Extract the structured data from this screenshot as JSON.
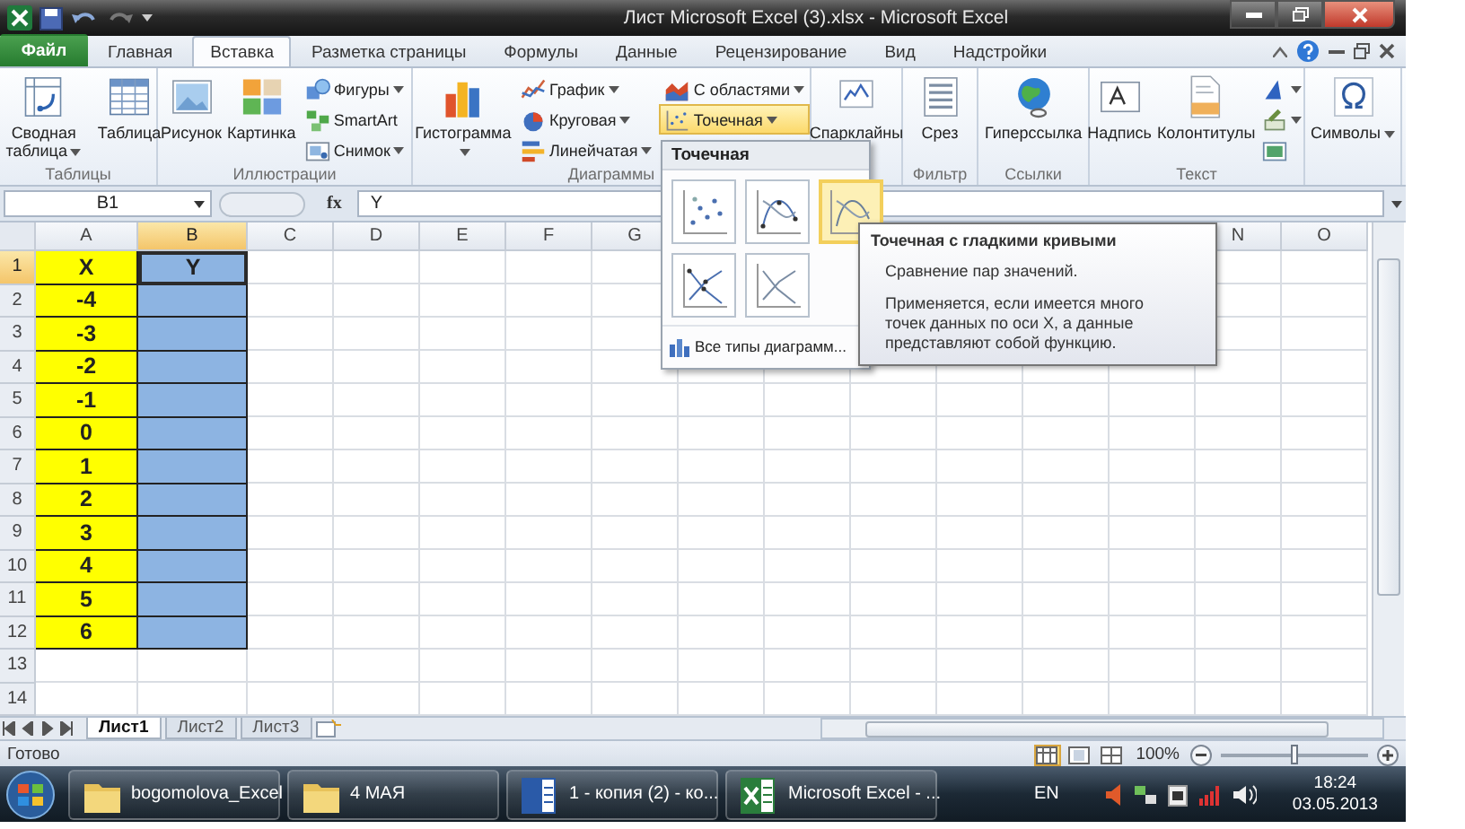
{
  "window": {
    "title": "Лист Microsoft Excel (3).xlsx - Microsoft Excel"
  },
  "ribbon_tabs": [
    {
      "label": "Файл",
      "kind": "file",
      "selected": false
    },
    {
      "label": "Главная",
      "kind": "tab",
      "selected": false
    },
    {
      "label": "Вставка",
      "kind": "tab",
      "selected": true
    },
    {
      "label": "Разметка страницы",
      "kind": "tab",
      "selected": false
    },
    {
      "label": "Формулы",
      "kind": "tab",
      "selected": false
    },
    {
      "label": "Данные",
      "kind": "tab",
      "selected": false
    },
    {
      "label": "Рецензирование",
      "kind": "tab",
      "selected": false
    },
    {
      "label": "Вид",
      "kind": "tab",
      "selected": false
    },
    {
      "label": "Надстройки",
      "kind": "tab",
      "selected": false
    }
  ],
  "ribbon_groups": [
    {
      "label": "Таблицы",
      "items": [
        {
          "kind": "large",
          "label": "Сводная таблица",
          "menu": true
        },
        {
          "kind": "large",
          "label": "Таблица",
          "menu": false
        }
      ]
    },
    {
      "label": "Иллюстрации",
      "items": [
        {
          "kind": "large",
          "label": "Рисунок",
          "menu": false
        },
        {
          "kind": "large",
          "label": "Картинка",
          "menu": false
        },
        {
          "kind": "stack",
          "items": [
            {
              "label": "Фигуры",
              "menu": true,
              "open": false
            },
            {
              "label": "SmartArt",
              "menu": false,
              "open": false
            },
            {
              "label": "Снимок",
              "menu": true,
              "open": false
            }
          ]
        }
      ]
    },
    {
      "label": "Диаграммы",
      "items": [
        {
          "kind": "large",
          "label": "Гистограмма",
          "menu": true
        },
        {
          "kind": "stack",
          "items": [
            {
              "label": "График",
              "menu": true,
              "open": false
            },
            {
              "label": "Круговая",
              "menu": true,
              "open": false
            },
            {
              "label": "Линейчатая",
              "menu": true,
              "open": false
            }
          ]
        },
        {
          "kind": "stack",
          "items": [
            {
              "label": "С областями",
              "menu": true,
              "open": false
            },
            {
              "label": "Точечная",
              "menu": true,
              "open": true
            }
          ]
        }
      ]
    },
    {
      "items": [
        {
          "kind": "large",
          "label": "Спарклайны",
          "menu": false
        }
      ]
    },
    {
      "label": "Фильтр",
      "items": [
        {
          "kind": "large",
          "label": "Срез",
          "menu": false
        }
      ]
    },
    {
      "label": "Ссылки",
      "items": [
        {
          "kind": "large",
          "label": "Гиперссылка",
          "menu": false
        }
      ]
    },
    {
      "label": "Текст",
      "items": [
        {
          "kind": "large",
          "label": "Надпись",
          "menu": false
        },
        {
          "kind": "large",
          "label": "Колонтитулы",
          "menu": false
        },
        {
          "kind": "stack",
          "items": [
            {
              "menu": true,
              "open": false
            },
            {
              "menu": true,
              "open": false
            },
            {
              "menu": false,
              "open": false
            }
          ]
        }
      ]
    },
    {
      "items": [
        {
          "kind": "large",
          "label": "Символы",
          "menu": true
        }
      ]
    }
  ],
  "formula_bar": {
    "name_box": "B1",
    "function_button": "fx",
    "formula": "Y"
  },
  "columns": [
    {
      "label": "A",
      "selected": false
    },
    {
      "label": "B",
      "selected": true
    },
    {
      "label": "C",
      "selected": false
    },
    {
      "label": "D",
      "selected": false
    },
    {
      "label": "E",
      "selected": false
    },
    {
      "label": "F",
      "selected": false
    },
    {
      "label": "G",
      "selected": false
    },
    {
      "label": "N",
      "selected": false
    },
    {
      "label": "O",
      "selected": false
    }
  ],
  "rows": [
    {
      "header": "1",
      "selected": true,
      "cells": [
        {
          "text": "X",
          "color": "#ffff00",
          "selected": false
        },
        {
          "text": "Y",
          "color": "#8db4e2",
          "selected": true
        }
      ]
    },
    {
      "header": "2",
      "selected": false,
      "cells": [
        {
          "text": "-4",
          "color": "#ffff00",
          "selected": false
        },
        {
          "color": "#8db4e2",
          "selected": false
        }
      ]
    },
    {
      "header": "3",
      "selected": false,
      "cells": [
        {
          "text": "-3",
          "color": "#ffff00",
          "selected": false
        },
        {
          "color": "#8db4e2",
          "selected": false
        }
      ]
    },
    {
      "header": "4",
      "selected": false,
      "cells": [
        {
          "text": "-2",
          "color": "#ffff00",
          "selected": false
        },
        {
          "color": "#8db4e2",
          "selected": false
        }
      ]
    },
    {
      "header": "5",
      "selected": false,
      "cells": [
        {
          "text": "-1",
          "color": "#ffff00",
          "selected": false
        },
        {
          "color": "#8db4e2",
          "selected": false
        }
      ]
    },
    {
      "header": "6",
      "selected": false,
      "cells": [
        {
          "text": "0",
          "color": "#ffff00",
          "selected": false
        },
        {
          "color": "#8db4e2",
          "selected": false
        }
      ]
    },
    {
      "header": "7",
      "selected": false,
      "cells": [
        {
          "text": "1",
          "color": "#ffff00",
          "selected": false
        },
        {
          "color": "#8db4e2",
          "selected": false
        }
      ]
    },
    {
      "header": "8",
      "selected": false,
      "cells": [
        {
          "text": "2",
          "color": "#ffff00",
          "selected": false
        },
        {
          "color": "#8db4e2",
          "selected": false
        }
      ]
    },
    {
      "header": "9",
      "selected": false,
      "cells": [
        {
          "text": "3",
          "color": "#ffff00",
          "selected": false
        },
        {
          "color": "#8db4e2",
          "selected": false
        }
      ]
    },
    {
      "header": "10",
      "selected": false,
      "cells": [
        {
          "text": "4",
          "color": "#ffff00",
          "selected": false
        },
        {
          "color": "#8db4e2",
          "selected": false
        }
      ]
    },
    {
      "header": "11",
      "selected": false,
      "cells": [
        {
          "text": "5",
          "color": "#ffff00",
          "selected": false
        },
        {
          "color": "#8db4e2",
          "selected": false
        }
      ]
    },
    {
      "header": "12",
      "selected": false,
      "cells": [
        {
          "text": "6",
          "color": "#ffff00",
          "selected": false
        },
        {
          "color": "#8db4e2",
          "selected": false
        }
      ]
    },
    {
      "header": "13",
      "selected": false
    },
    {
      "header": "14",
      "selected": false
    }
  ],
  "chart_menu": {
    "title": "Точечная",
    "options": [
      {
        "selected": false
      },
      {
        "selected": false
      },
      {
        "selected": true
      },
      {
        "selected": false
      },
      {
        "selected": false
      }
    ],
    "link": "Все типы диаграмм..."
  },
  "tooltip": {
    "title": "Точечная с гладкими кривыми",
    "paragraphs": [
      "Сравнение пар значений.",
      "Применяется, если имеется много точек данных по оси X, а данные представляют собой функцию."
    ]
  },
  "sheet_tabs": [
    {
      "label": "Лист1",
      "selected": true
    },
    {
      "label": "Лист2",
      "selected": false
    },
    {
      "label": "Лист3",
      "selected": false
    }
  ],
  "status_bar": {
    "text": "Готово",
    "views": [
      {
        "selected": true
      },
      {
        "selected": false
      },
      {
        "selected": false
      }
    ],
    "zoom": "100%",
    "zoom_slider": {
      "level": 0.5
    }
  },
  "taskbar": {
    "buttons": [
      {
        "kind": "folder",
        "label": "bogomolova_Excel"
      },
      {
        "kind": "folder",
        "label": "4 МАЯ"
      },
      {
        "kind": "word",
        "label": "1 - копия (2) - ко..."
      },
      {
        "kind": "excel",
        "label": "Microsoft Excel - ..."
      }
    ],
    "language": "EN",
    "time": "18:24",
    "date": "03.05.2013"
  }
}
